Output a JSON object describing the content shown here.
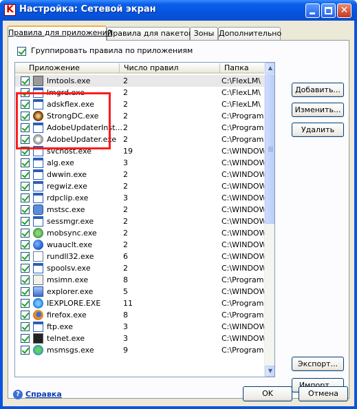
{
  "window": {
    "title": "Настройка: Сетевой экран",
    "app_icon_letter": "K"
  },
  "tabs": [
    {
      "label": "Правила для приложений",
      "active": true
    },
    {
      "label": "Правила для пакетов",
      "active": false
    },
    {
      "label": "Зоны",
      "active": false
    },
    {
      "label": "Дополнительно",
      "active": false
    }
  ],
  "group_by_app": {
    "label": "Группировать правила по приложениям",
    "checked": true
  },
  "list": {
    "columns": [
      "Приложение",
      "Число правил",
      "Папка"
    ],
    "rows": [
      {
        "name": "lmtools.exe",
        "count": "2",
        "folder": "C:\\FlexLM\\",
        "icon": "tool-icon",
        "checked": true,
        "selected": true
      },
      {
        "name": "lmgrd.exe",
        "count": "2",
        "folder": "C:\\FlexLM\\",
        "icon": "window-icon",
        "checked": true
      },
      {
        "name": "adskflex.exe",
        "count": "2",
        "folder": "C:\\FlexLM\\",
        "icon": "window-icon",
        "checked": true
      },
      {
        "name": "StrongDC.exe",
        "count": "2",
        "folder": "C:\\Program Files",
        "icon": "disc-icon",
        "checked": true
      },
      {
        "name": "AdobeUpdaterInst...",
        "count": "2",
        "folder": "C:\\Program Files",
        "icon": "window-icon",
        "checked": true
      },
      {
        "name": "AdobeUpdater.exe",
        "count": "2",
        "folder": "C:\\Program Files",
        "icon": "gear-icon",
        "checked": true
      },
      {
        "name": "svchost.exe",
        "count": "19",
        "folder": "C:\\WINDOWS\\sy",
        "icon": "window-icon",
        "checked": true
      },
      {
        "name": "alg.exe",
        "count": "3",
        "folder": "C:\\WINDOWS\\sy",
        "icon": "window-icon",
        "checked": true
      },
      {
        "name": "dwwin.exe",
        "count": "2",
        "folder": "C:\\WINDOWS\\sy",
        "icon": "window-icon",
        "checked": true
      },
      {
        "name": "regwiz.exe",
        "count": "2",
        "folder": "C:\\WINDOWS\\sy",
        "icon": "window-icon",
        "checked": true
      },
      {
        "name": "rdpclip.exe",
        "count": "3",
        "folder": "C:\\WINDOWS\\sy",
        "icon": "window-icon",
        "checked": true
      },
      {
        "name": "mstsc.exe",
        "count": "2",
        "folder": "C:\\WINDOWS\\sy",
        "icon": "remote-desktop-icon",
        "checked": true
      },
      {
        "name": "sessmgr.exe",
        "count": "2",
        "folder": "C:\\WINDOWS\\sy",
        "icon": "window-icon",
        "checked": true
      },
      {
        "name": "mobsync.exe",
        "count": "2",
        "folder": "C:\\WINDOWS\\sy",
        "icon": "sync-icon",
        "checked": true
      },
      {
        "name": "wuauclt.exe",
        "count": "2",
        "folder": "C:\\WINDOWS\\sy",
        "icon": "globe-icon",
        "checked": true
      },
      {
        "name": "rundll32.exe",
        "count": "6",
        "folder": "C:\\WINDOWS\\sy",
        "icon": "file-icon",
        "checked": true
      },
      {
        "name": "spoolsv.exe",
        "count": "2",
        "folder": "C:\\WINDOWS\\sy",
        "icon": "window-icon",
        "checked": true
      },
      {
        "name": "msimn.exe",
        "count": "8",
        "folder": "C:\\Program Files",
        "icon": "mail-icon",
        "checked": true
      },
      {
        "name": "explorer.exe",
        "count": "5",
        "folder": "C:\\WINDOWS\\",
        "icon": "computer-icon",
        "checked": true
      },
      {
        "name": "IEXPLORE.EXE",
        "count": "11",
        "folder": "C:\\Program Files",
        "icon": "ie-icon",
        "checked": true
      },
      {
        "name": "firefox.exe",
        "count": "8",
        "folder": "C:\\Program Files",
        "icon": "firefox-icon",
        "checked": true
      },
      {
        "name": "ftp.exe",
        "count": "3",
        "folder": "C:\\WINDOWS\\sy",
        "icon": "window-icon",
        "checked": true
      },
      {
        "name": "telnet.exe",
        "count": "3",
        "folder": "C:\\WINDOWS\\sy",
        "icon": "terminal-icon",
        "checked": true
      },
      {
        "name": "msmsgs.exe",
        "count": "9",
        "folder": "C:\\Program Files",
        "icon": "messenger-icon",
        "checked": true
      }
    ]
  },
  "buttons": {
    "add": "Добавить...",
    "edit": "Изменить...",
    "delete": "Удалить",
    "export": "Экспорт...",
    "import": "Импорт...",
    "ok": "OK",
    "cancel": "Отмена"
  },
  "help": {
    "label": "Справка"
  },
  "colors": {
    "title_bar": "#0a5fe8",
    "highlight": "#ff1a1a",
    "checkmark": "#21a121"
  }
}
